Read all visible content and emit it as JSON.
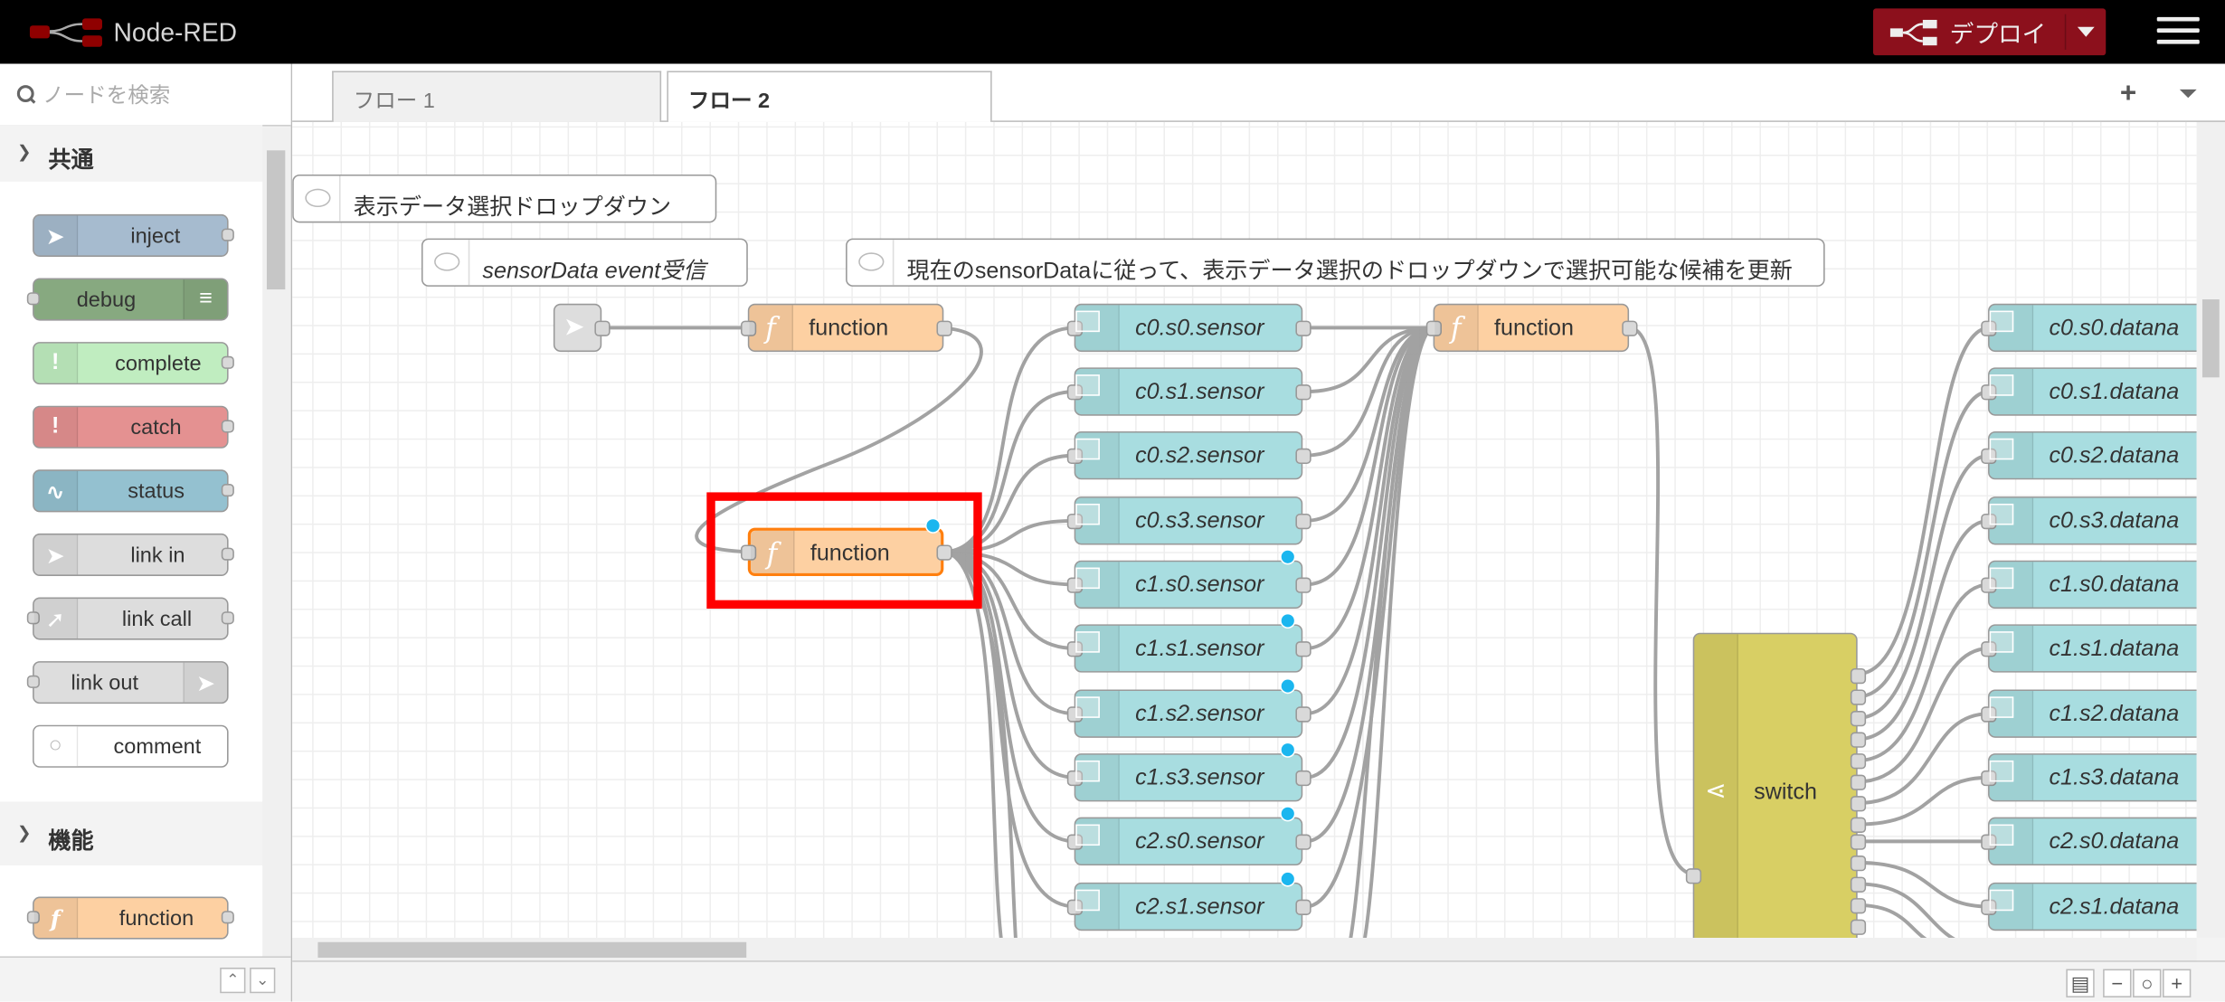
{
  "header": {
    "app_title": "Node-RED",
    "deploy_label": "デプロイ"
  },
  "palette": {
    "search_placeholder": "ノードを検索",
    "categories": [
      {
        "title": "共通",
        "nodes": [
          {
            "label": "inject",
            "color": "#a6bbcf"
          },
          {
            "label": "debug",
            "color": "#87a980"
          },
          {
            "label": "complete",
            "color": "#c0edc0"
          },
          {
            "label": "catch",
            "color": "#e49191"
          },
          {
            "label": "status",
            "color": "#94c1d0"
          },
          {
            "label": "link in",
            "color": "#dddddd"
          },
          {
            "label": "link call",
            "color": "#dddddd"
          },
          {
            "label": "link out",
            "color": "#dddddd"
          },
          {
            "label": "comment",
            "color": "#ffffff"
          }
        ]
      },
      {
        "title": "機能",
        "nodes": [
          {
            "label": "function",
            "color": "#fdd0a2"
          }
        ]
      }
    ]
  },
  "tabs": [
    {
      "label": "フロー 1",
      "active": false
    },
    {
      "label": "フロー 2",
      "active": true
    }
  ],
  "flow": {
    "comments": [
      {
        "label": "表示データ選択ドロップダウン"
      },
      {
        "label": "sensorData event受信"
      },
      {
        "label": "現在のsensorDataに従って、表示データ選択のドロップダウンで選択可能な候補を更新"
      }
    ],
    "function_label": "function",
    "switch_label": "switch",
    "sensor_nodes": [
      "c0.s0.sensor",
      "c0.s1.sensor",
      "c0.s2.sensor",
      "c0.s3.sensor",
      "c1.s0.sensor",
      "c1.s1.sensor",
      "c1.s2.sensor",
      "c1.s3.sensor",
      "c2.s0.sensor",
      "c2.s1.sensor"
    ],
    "datana_nodes": [
      "c0.s0.datana",
      "c0.s1.datana",
      "c0.s2.datana",
      "c0.s3.datana",
      "c1.s0.datana",
      "c1.s1.datana",
      "c1.s2.datana",
      "c1.s3.datana",
      "c2.s0.datana",
      "c2.s1.datana"
    ],
    "colors": {
      "function": "#fdd0a2",
      "debug_ui": "#a8dde0",
      "switch": "#d8cf64",
      "inject": "#dddddd",
      "highlight": "#ff0000",
      "status_dot": "#1bb6ef"
    }
  }
}
